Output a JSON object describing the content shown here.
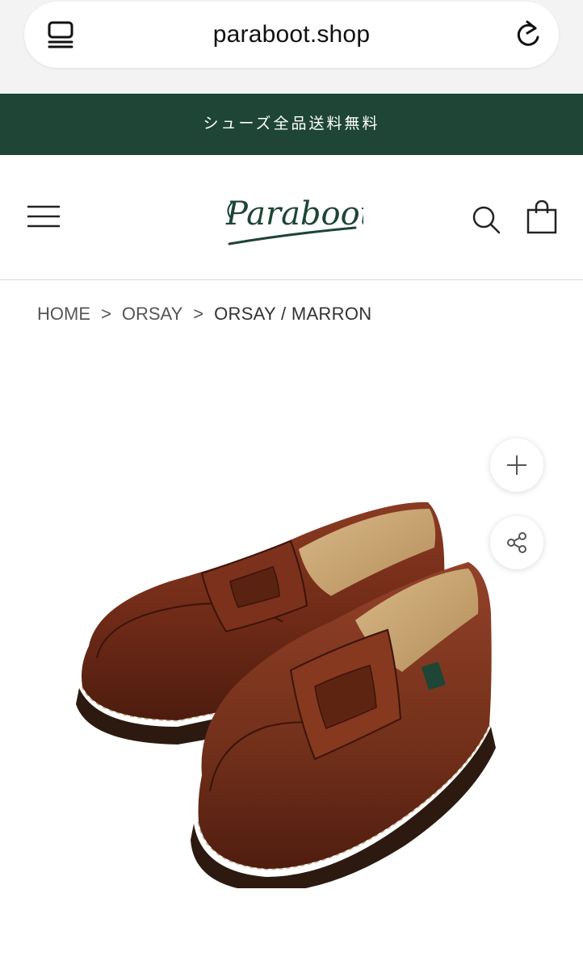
{
  "browser": {
    "url": "paraboot.shop",
    "tabs_icon": "tabs-icon",
    "reload_icon": "reload-icon"
  },
  "banner": {
    "text": "シューズ全品送料無料",
    "color": "#1e4535"
  },
  "header": {
    "menu_icon": "hamburger-menu-icon",
    "logo_text": "Paraboot",
    "search_icon": "search-icon",
    "cart_icon": "shopping-bag-icon"
  },
  "breadcrumb": {
    "items": [
      "HOME",
      "ORSAY"
    ],
    "separator": ">",
    "current": "ORSAY / MARRON"
  },
  "product": {
    "image_alt": "brown leather penny loafers",
    "actions": {
      "add_icon": "plus-icon",
      "share_icon": "share-icon"
    }
  }
}
